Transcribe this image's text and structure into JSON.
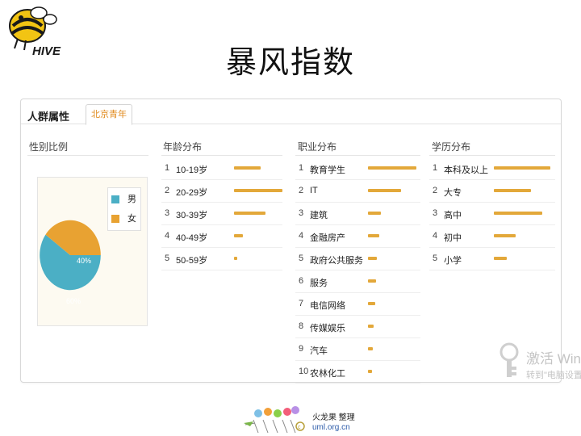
{
  "logo": {
    "text": "HIVE",
    "colors": {
      "yellow": "#f2c413",
      "black": "#1a1a1a"
    }
  },
  "slide": {
    "title": "暴风指数"
  },
  "panel": {
    "title": "人群属性",
    "tab_label": "北京青年",
    "gender": {
      "header": "性别比例",
      "legend": [
        {
          "label": "男",
          "color": "#4bafc5"
        },
        {
          "label": "女",
          "color": "#e8a232"
        }
      ],
      "slices": [
        {
          "label": "60%",
          "value": 60,
          "color": "#4bafc5"
        },
        {
          "label": "40%",
          "value": 40,
          "color": "#e8a232"
        }
      ]
    },
    "age": {
      "header": "年龄分布",
      "items": [
        {
          "rank": "1",
          "name": "10-19岁",
          "level": 0.55
        },
        {
          "rank": "2",
          "name": "20-29岁",
          "level": 1.0
        },
        {
          "rank": "3",
          "name": "30-39岁",
          "level": 0.65
        },
        {
          "rank": "4",
          "name": "40-49岁",
          "level": 0.18
        },
        {
          "rank": "5",
          "name": "50-59岁",
          "level": 0.06
        }
      ]
    },
    "occupation": {
      "header": "职业分布",
      "items": [
        {
          "rank": "1",
          "name": "教育学生",
          "level": 1.0
        },
        {
          "rank": "2",
          "name": "IT",
          "level": 0.68
        },
        {
          "rank": "3",
          "name": "建筑",
          "level": 0.27
        },
        {
          "rank": "4",
          "name": "金融房产",
          "level": 0.23
        },
        {
          "rank": "5",
          "name": "政府公共服务",
          "level": 0.18
        },
        {
          "rank": "6",
          "name": "服务",
          "level": 0.17
        },
        {
          "rank": "7",
          "name": "电信网络",
          "level": 0.15
        },
        {
          "rank": "8",
          "name": "传媒娱乐",
          "level": 0.12
        },
        {
          "rank": "9",
          "name": "汽车",
          "level": 0.1
        },
        {
          "rank": "10",
          "name": "农林化工",
          "level": 0.09
        }
      ]
    },
    "education": {
      "header": "学历分布",
      "items": [
        {
          "rank": "1",
          "name": "本科及以上",
          "level": 1.0
        },
        {
          "rank": "2",
          "name": "大专",
          "level": 0.65
        },
        {
          "rank": "3",
          "name": "高中",
          "level": 0.85
        },
        {
          "rank": "4",
          "name": "初中",
          "level": 0.38
        },
        {
          "rank": "5",
          "name": "小学",
          "level": 0.23
        }
      ]
    },
    "bar_color": "#e3a83a"
  },
  "footer": {
    "name": "火龙果 整理",
    "url": "uml.org.cn"
  },
  "watermark": {
    "line1": "激活 Wind",
    "line2": "转到\"电脑设置\""
  }
}
